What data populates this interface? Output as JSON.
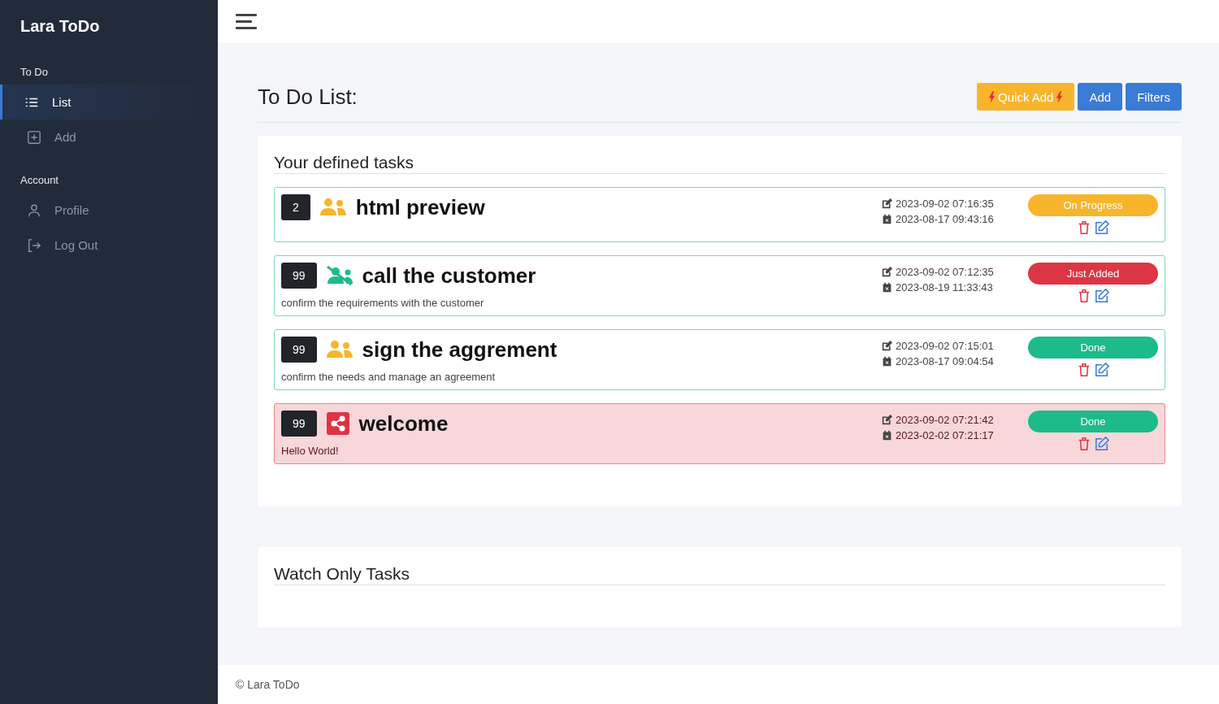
{
  "app": {
    "title": "Lara ToDo"
  },
  "sidebar": {
    "sections": [
      {
        "heading": "To Do",
        "items": [
          {
            "label": "List",
            "kind": "list",
            "selected": true
          },
          {
            "label": "Add",
            "kind": "add",
            "selected": false
          }
        ]
      },
      {
        "heading": "Account",
        "items": [
          {
            "label": "Profile",
            "kind": "profile",
            "selected": false
          },
          {
            "label": "Log Out",
            "kind": "logout",
            "selected": false
          }
        ]
      }
    ]
  },
  "page": {
    "title": "To Do List:",
    "buttons": [
      {
        "label": "Quick Add",
        "kind": "quick"
      },
      {
        "label": "Add",
        "kind": "primary"
      },
      {
        "label": "Filters",
        "kind": "primary"
      }
    ]
  },
  "tasks_panel": {
    "title": "Your defined tasks",
    "tasks": [
      {
        "count": "2",
        "kind": "group",
        "title": "html preview",
        "updated": "2023-09-02 07:16:35",
        "created": "2023-08-17 09:43:16",
        "status": "On Progress",
        "color": "#f8b52c",
        "highlighted": false
      },
      {
        "count": "99",
        "kind": "group-off",
        "title": "call the customer",
        "description": "confirm the requirements with the customer",
        "updated": "2023-09-02 07:12:35",
        "created": "2023-08-19 11:33:43",
        "status": "Just Added",
        "color": "#dc3545",
        "highlighted": false
      },
      {
        "count": "99",
        "kind": "group",
        "title": "sign the aggrement",
        "description": "confirm the needs and manage an agreement",
        "updated": "2023-09-02 07:15:01",
        "created": "2023-08-17 09:04:54",
        "status": "Done",
        "color": "#1dbb8a",
        "highlighted": false
      },
      {
        "count": "99",
        "kind": "share",
        "title": "welcome",
        "description": "Hello World!",
        "updated": "2023-09-02 07:21:42",
        "created": "2023-02-02 07:21:17",
        "status": "Done",
        "color": "#1dbb8a",
        "highlighted": true
      }
    ]
  },
  "watch_panel": {
    "title": "Watch Only Tasks"
  },
  "footer": {
    "text": "© Lara ToDo"
  }
}
